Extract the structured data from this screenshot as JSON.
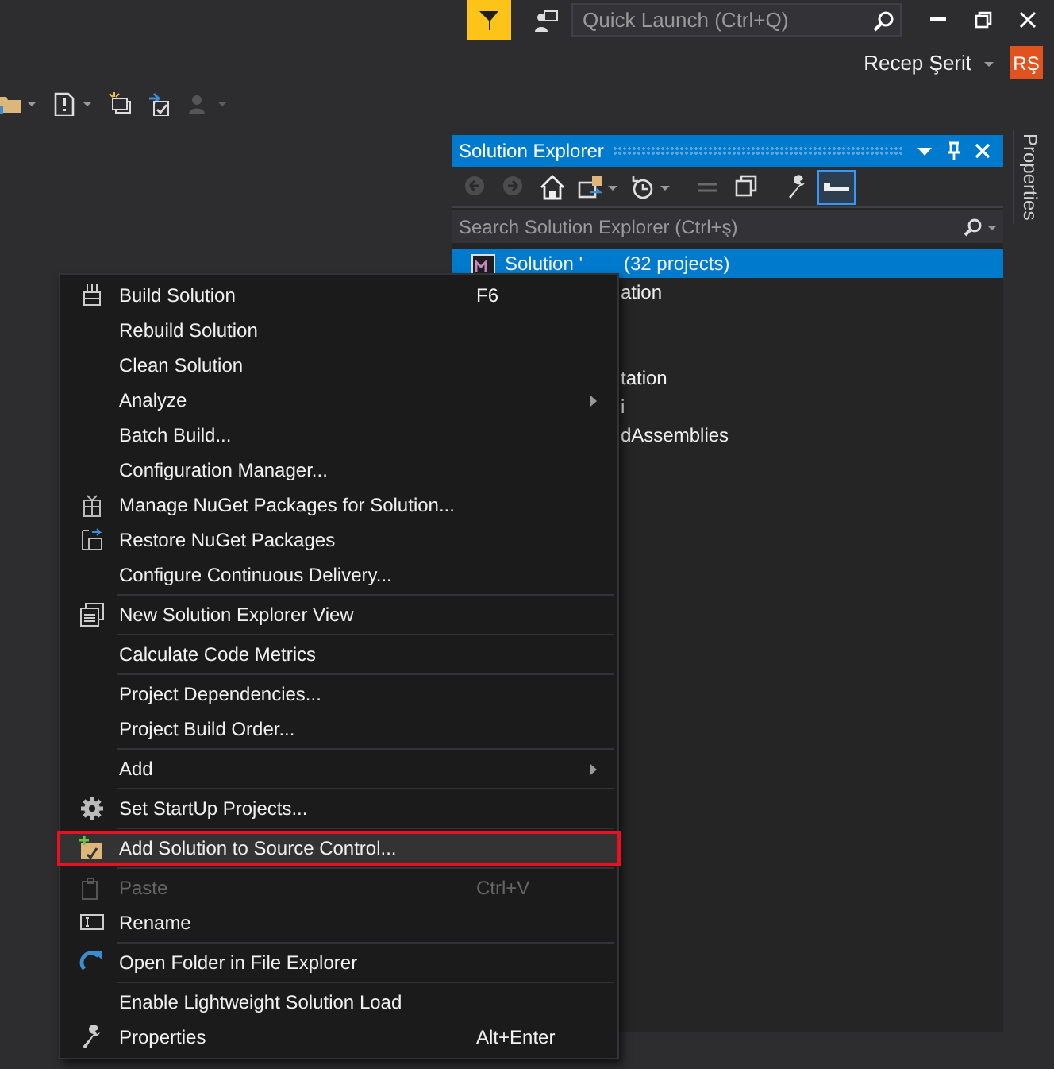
{
  "title_bar": {
    "quick_launch": {
      "placeholder": "Quick Launch (Ctrl+Q)"
    },
    "user": {
      "name": "Recep Şerit",
      "initials": "RŞ"
    }
  },
  "toolbar": [
    {
      "disabled": false
    },
    {
      "disabled": false
    },
    {
      "disabled": false
    },
    {
      "disabled": false
    },
    {
      "disabled": true
    }
  ],
  "solution_explorer": {
    "title": "Solution Explorer",
    "toolbar": [
      {
        "disabled": true,
        "selected": false
      },
      {
        "disabled": true,
        "selected": false
      },
      {
        "disabled": false,
        "selected": false
      },
      {
        "disabled": false,
        "selected": false
      },
      {
        "disabled": false,
        "selected": false
      },
      {
        "disabled": true,
        "selected": false
      },
      {
        "disabled": false,
        "selected": false
      },
      {
        "disabled": false,
        "selected": false
      },
      {
        "disabled": false,
        "selected": true
      }
    ],
    "search": {
      "placeholder": "Search Solution Explorer (Ctrl+ş)"
    },
    "tree": [
      {
        "label": "Solution '",
        "count": "(32 projects)",
        "selected": true
      },
      {
        "label": "ation",
        "selected": false
      },
      {
        "label": "tation",
        "selected": false
      },
      {
        "label": "i",
        "selected": false
      },
      {
        "label": "dAssemblies",
        "selected": false
      }
    ]
  },
  "side_tabs": [
    {
      "label": "Properties"
    }
  ],
  "context_menu": {
    "groups": [
      [
        {
          "label": "Build Solution",
          "shortcut": "F6",
          "submenu": false,
          "disabled": false,
          "selected": false
        },
        {
          "label": "Rebuild Solution",
          "submenu": false,
          "disabled": false,
          "selected": false
        },
        {
          "label": "Clean Solution",
          "submenu": false,
          "disabled": false,
          "selected": false
        },
        {
          "label": "Analyze",
          "submenu": true,
          "disabled": false,
          "selected": false
        },
        {
          "label": "Batch Build...",
          "submenu": false,
          "disabled": false,
          "selected": false
        },
        {
          "label": "Configuration Manager...",
          "submenu": false,
          "disabled": false,
          "selected": false
        },
        {
          "label": "Manage NuGet Packages for Solution...",
          "submenu": false,
          "disabled": false,
          "selected": false
        },
        {
          "label": "Restore NuGet Packages",
          "submenu": false,
          "disabled": false,
          "selected": false
        },
        {
          "label": "Configure Continuous Delivery...",
          "submenu": false,
          "disabled": false,
          "selected": false
        }
      ],
      [
        {
          "label": "New Solution Explorer View",
          "submenu": false,
          "disabled": false,
          "selected": false
        }
      ],
      [
        {
          "label": "Calculate Code Metrics",
          "submenu": false,
          "disabled": false,
          "selected": false
        }
      ],
      [
        {
          "label": "Project Dependencies...",
          "submenu": false,
          "disabled": false,
          "selected": false
        },
        {
          "label": "Project Build Order...",
          "submenu": false,
          "disabled": false,
          "selected": false
        }
      ],
      [
        {
          "label": "Add",
          "submenu": true,
          "disabled": false,
          "selected": false
        }
      ],
      [
        {
          "label": "Set StartUp Projects...",
          "submenu": false,
          "disabled": false,
          "selected": false
        }
      ],
      [
        {
          "label": "Add Solution to Source Control...",
          "submenu": false,
          "disabled": false,
          "selected": true
        }
      ],
      [
        {
          "label": "Paste",
          "shortcut": "Ctrl+V",
          "submenu": false,
          "disabled": true,
          "selected": false
        },
        {
          "label": "Rename",
          "submenu": false,
          "disabled": false,
          "selected": false
        }
      ],
      [
        {
          "label": "Open Folder in File Explorer",
          "submenu": false,
          "disabled": false,
          "selected": false
        }
      ],
      [
        {
          "label": "Enable Lightweight Solution Load",
          "submenu": false,
          "disabled": false,
          "selected": false
        },
        {
          "label": "Properties",
          "shortcut": "Alt+Enter",
          "submenu": false,
          "disabled": false,
          "selected": false
        }
      ]
    ]
  }
}
